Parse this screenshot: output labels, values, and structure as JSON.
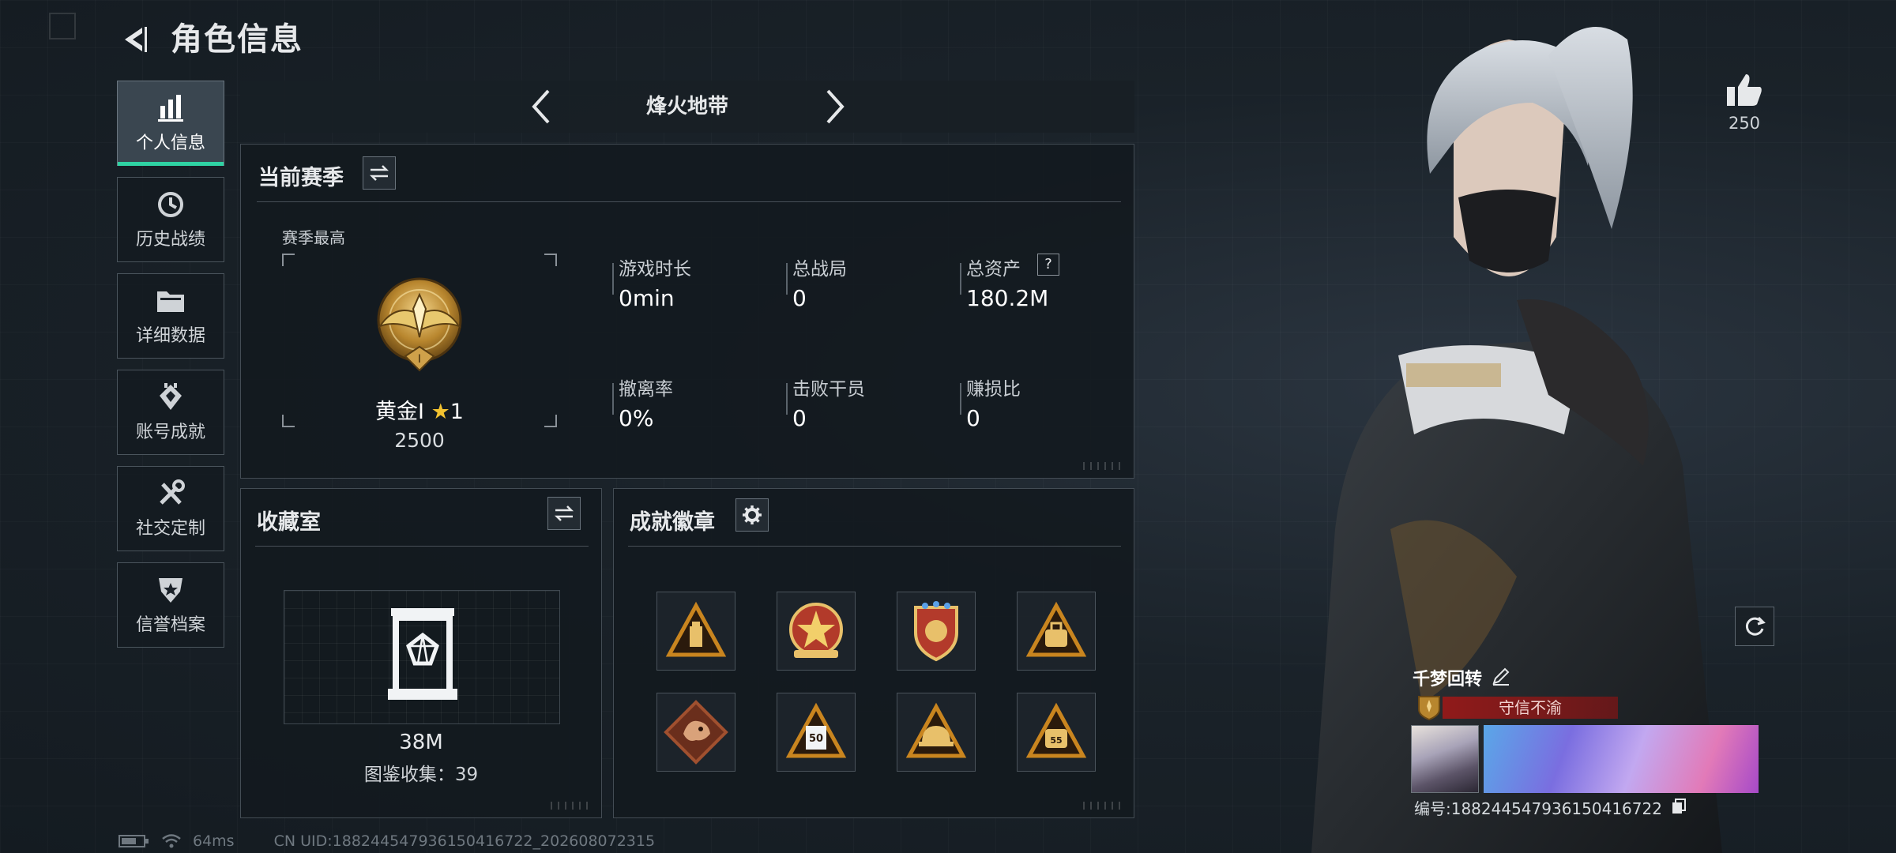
{
  "header": {
    "title": "角色信息"
  },
  "sidebar": {
    "items": [
      {
        "label": "个人信息",
        "icon": "bar-chart-icon",
        "active": true
      },
      {
        "label": "历史战绩",
        "icon": "history-clock-icon",
        "active": false
      },
      {
        "label": "详细数据",
        "icon": "folder-icon",
        "active": false
      },
      {
        "label": "账号成就",
        "icon": "achievement-diamond-icon",
        "active": false
      },
      {
        "label": "社交定制",
        "icon": "tools-icon",
        "active": false
      },
      {
        "label": "信誉档案",
        "icon": "shield-star-icon",
        "active": false
      }
    ]
  },
  "mode": {
    "name": "烽火地带"
  },
  "season": {
    "title": "当前赛季",
    "best_label": "赛季最高",
    "rank_name": "黄金I",
    "rank_stars": "1",
    "rank_score": "2500",
    "stats": [
      {
        "label": "游戏时长",
        "value": "0min"
      },
      {
        "label": "总战局",
        "value": "0"
      },
      {
        "label": "总资产",
        "value": "180.2M"
      },
      {
        "label": "撤离率",
        "value": "0%"
      },
      {
        "label": "击败干员",
        "value": "0"
      },
      {
        "label": "赚损比",
        "value": "0"
      }
    ],
    "help_glyph": "?"
  },
  "collection": {
    "title": "收藏室",
    "value": "38M",
    "count_text": "图鉴收集：39"
  },
  "badges": {
    "title": "成就徽章",
    "items": [
      {
        "icon": "triangle-badge-icon",
        "color": "#c9851f"
      },
      {
        "icon": "star-emblem-badge-icon",
        "color": "#b23a2a"
      },
      {
        "icon": "shield-badge-icon",
        "color": "#b33a2b"
      },
      {
        "icon": "triangle-bag-badge-icon",
        "color": "#c9851f"
      },
      {
        "icon": "dragon-diamond-badge-icon",
        "color": "#a0502f"
      },
      {
        "icon": "triangle-50-badge-icon",
        "color": "#c9851f"
      },
      {
        "icon": "triangle-helmet-badge-icon",
        "color": "#c9851f"
      },
      {
        "icon": "triangle-bag2-badge-icon",
        "color": "#c9851f"
      }
    ]
  },
  "profile": {
    "likes": "250",
    "player_name": "千梦回转",
    "title_banner": "守信不渝",
    "uid_text": "编号:1882445479361504167​22"
  },
  "status": {
    "ping": "64ms",
    "uid_line": "CN UID:1882445479361504167​22_202608072315"
  },
  "colors": {
    "accent": "#2fd2a3",
    "panel_border": "#434c54",
    "star": "#f2c230",
    "title_red": "#961919"
  }
}
